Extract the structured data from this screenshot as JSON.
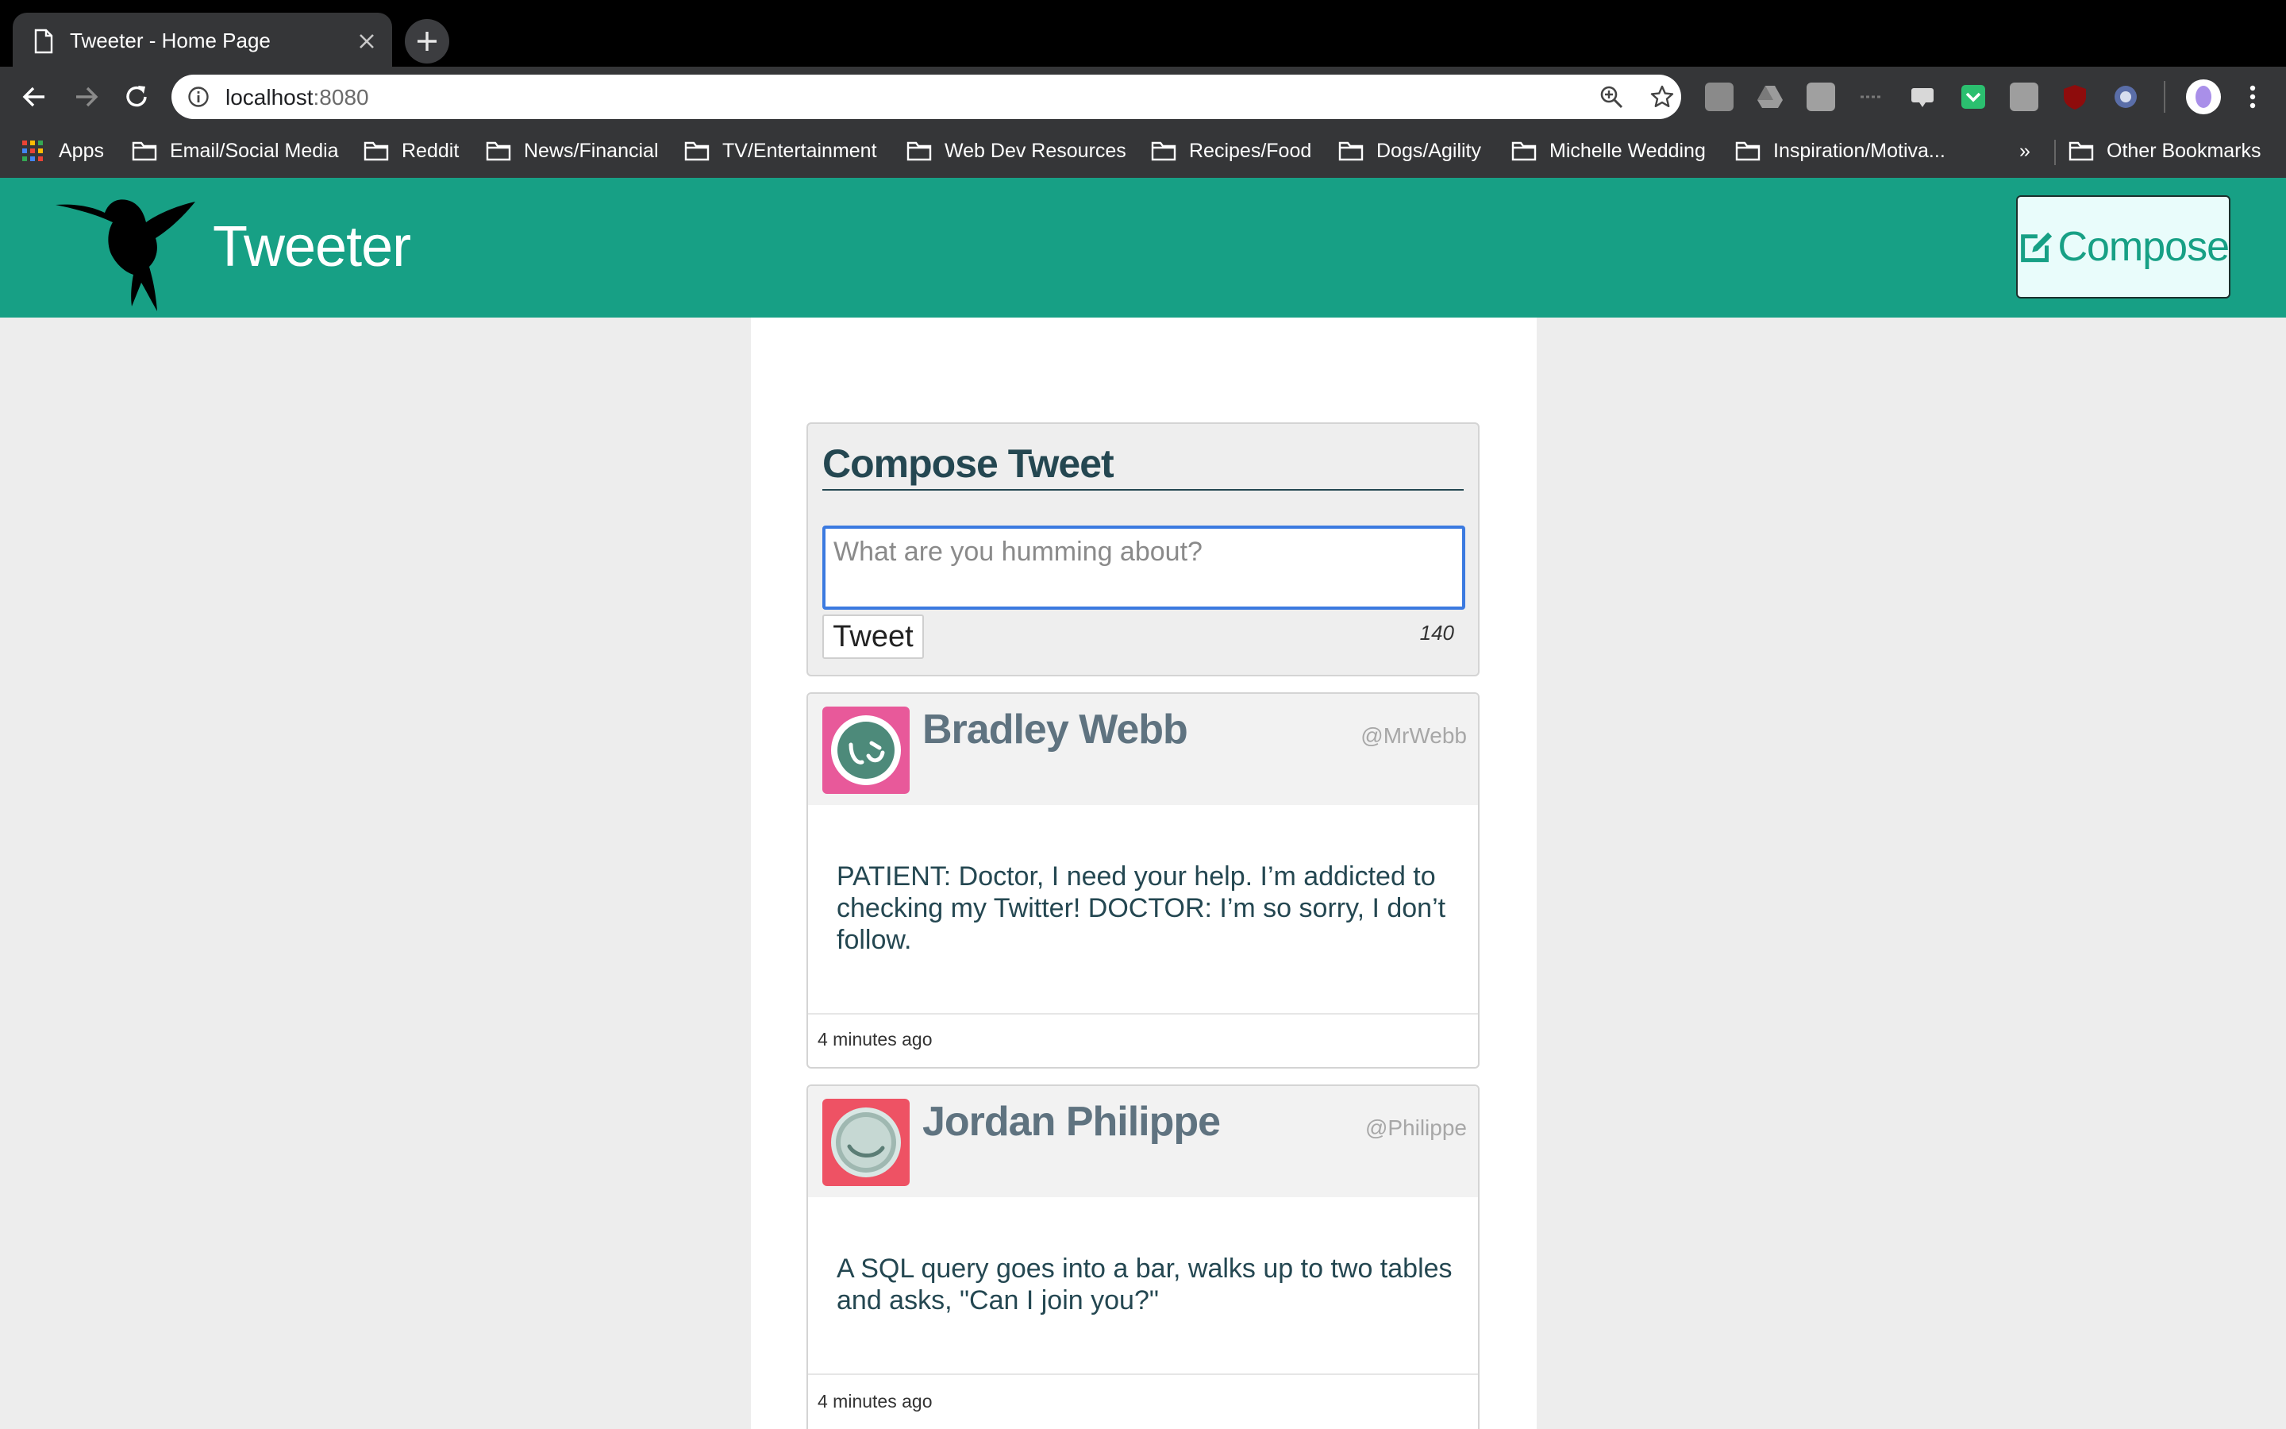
{
  "browser": {
    "tab": {
      "title": "Tweeter - Home Page",
      "favicon": "document-icon"
    },
    "address": {
      "host": "localhost",
      "port": ":8080"
    },
    "bookmarks": [
      "Apps",
      "Email/Social Media",
      "Reddit",
      "News/Financial",
      "TV/Entertainment",
      "Web Dev Resources",
      "Recipes/Food",
      "Dogs/Agility",
      "Michelle Wedding",
      "Inspiration/Motiva...",
      "»",
      "Other Bookmarks"
    ]
  },
  "header": {
    "brand": "Tweeter",
    "compose_label": "Compose",
    "logo": "hummingbird-logo",
    "colors": {
      "header_bg": "#17a085",
      "compose_bg": "#e9fcfb"
    }
  },
  "composer": {
    "title": "Compose Tweet",
    "placeholder": "What are you humming about?",
    "button_label": "Tweet",
    "counter": "140"
  },
  "tweets": [
    {
      "name": "Bradley Webb",
      "handle": "@MrWebb",
      "text": "PATIENT: Doctor, I need your help. I’m addicted to checking my Twitter!  DOCTOR: I’m so sorry, I don’t follow.",
      "time": "4 minutes ago",
      "avatar_color": "#e8599a"
    },
    {
      "name": "Jordan Philippe",
      "handle": "@Philippe",
      "text": "A SQL query goes into a bar, walks up to two tables and asks, \"Can I join you?\"",
      "time": "4 minutes ago",
      "avatar_color": "#ee5264"
    }
  ]
}
